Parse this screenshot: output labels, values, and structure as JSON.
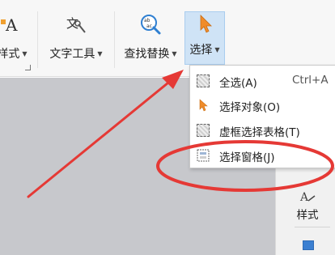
{
  "ribbon": {
    "styles_label": "样式",
    "text_tools_label": "文字工具",
    "find_replace_label": "查找替换",
    "select_label": "选择",
    "styles_icon": "styles-icon",
    "text_tools_icon": "text-tools-icon",
    "find_replace_icon": "find-replace-icon",
    "select_icon": "cursor-arrow-icon"
  },
  "select_menu": {
    "items": [
      {
        "label": "全选(A)",
        "shortcut": "Ctrl+A",
        "icon": "select-all-icon"
      },
      {
        "label": "选择对象(O)",
        "icon": "select-objects-icon"
      },
      {
        "label": "虚框选择表格(T)",
        "icon": "dashed-table-select-icon"
      },
      {
        "label": "选择窗格(J)",
        "icon": "selection-pane-icon"
      }
    ]
  },
  "side_pane": {
    "style_label": "样式",
    "style_icon": "style-brush-icon"
  },
  "annotation": {
    "color": "#e53935"
  },
  "colors": {
    "select_highlight": "#cfe3f6",
    "select_highlight_border": "#a9cdee",
    "cursor_orange": "#f08c2a",
    "canvas_gray": "#c7c8cc"
  }
}
